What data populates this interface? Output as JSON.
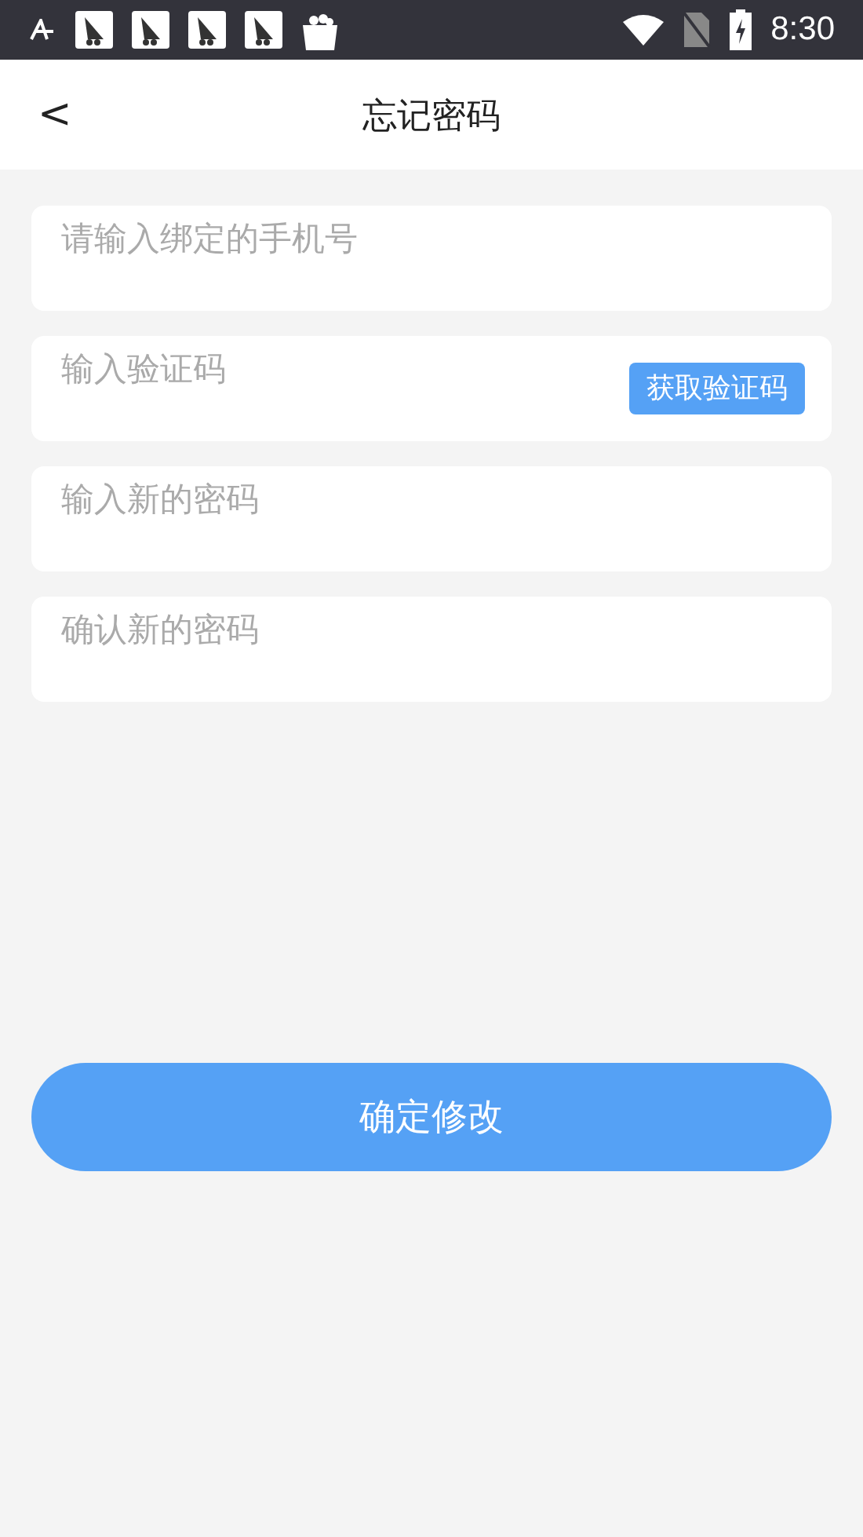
{
  "status_bar": {
    "time": "8:30"
  },
  "header": {
    "back": "<",
    "title": "忘记密码"
  },
  "fields": [
    {
      "kind": "text",
      "placeholder": "请输入绑定的手机号"
    },
    {
      "kind": "code",
      "placeholder": "输入验证码",
      "button": "获取验证码"
    },
    {
      "kind": "text",
      "placeholder": "输入新的密码"
    },
    {
      "kind": "text",
      "placeholder": "确认新的密码"
    }
  ],
  "submit": "确定修改"
}
